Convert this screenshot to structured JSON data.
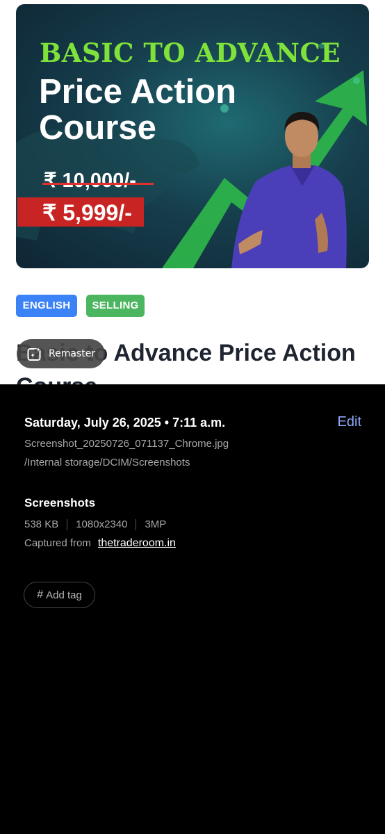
{
  "banner": {
    "line1": "BASIC TO ADVANCE",
    "line2": "Price Action",
    "line3": "Course",
    "old_price": "₹ 10,000/-",
    "new_price": "₹ 5,999/-"
  },
  "tags": {
    "language": "ENGLISH",
    "status": "SELLING"
  },
  "course_title": "Basic to Advance Price Action Course",
  "remaster": {
    "label": "Remaster",
    "icon": "sparkle-frame-icon"
  },
  "details": {
    "date": "Saturday, July 26, 2025 • 7:11 a.m.",
    "edit_label": "Edit",
    "file_name": "Screenshot_20250726_071137_Chrome.jpg",
    "file_path": "/Internal storage/DCIM/Screenshots",
    "album": "Screenshots",
    "size": "538 KB",
    "resolution": "1080x2340",
    "megapixels": "3MP",
    "captured_label": "Captured from",
    "captured_source": "thetraderoom.in",
    "add_tag_label": "Add tag",
    "add_tag_icon": "hash-icon"
  },
  "colors": {
    "accent_blue": "#3b82f6",
    "accent_green": "#4cb560",
    "edit_link": "#8ea8f8",
    "price_red": "#c82424",
    "title_green": "#7fe23a"
  }
}
